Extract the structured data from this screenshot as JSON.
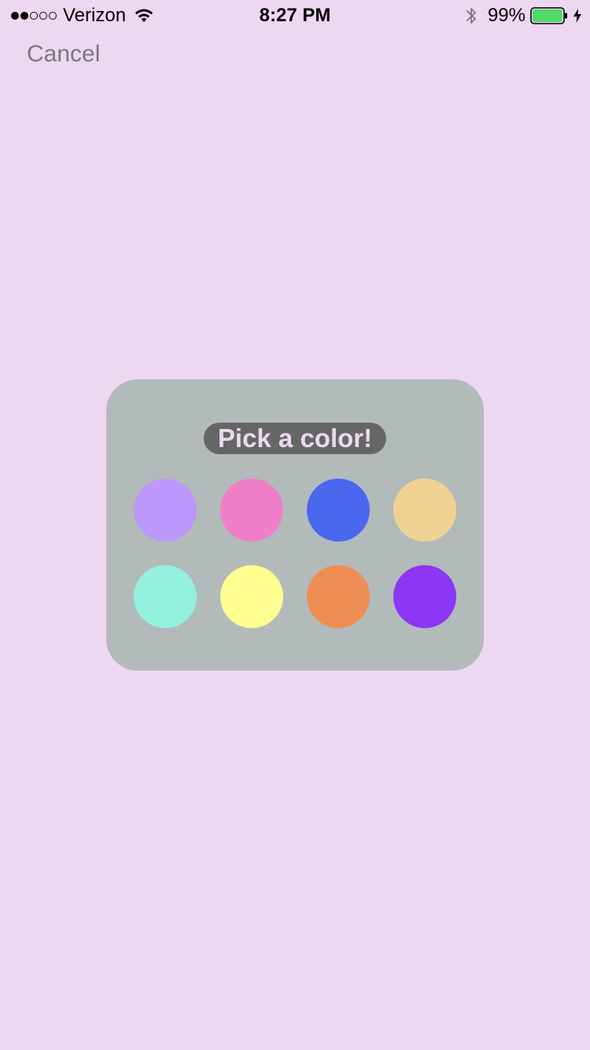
{
  "status_bar": {
    "carrier": "Verizon",
    "time": "8:27 PM",
    "battery_percent": "99%",
    "signal_bars_filled": 2,
    "signal_bars_total": 5,
    "battery_level": 0.99,
    "battery_color": "#4cd964",
    "icons": [
      "wifi-icon",
      "bluetooth-icon",
      "battery-icon",
      "charging-bolt-icon"
    ]
  },
  "nav": {
    "cancel_label": "Cancel"
  },
  "picker": {
    "title": "Pick a color!",
    "swatches": [
      {
        "color": "#bd97fb"
      },
      {
        "color": "#f07fc8"
      },
      {
        "color": "#4967ef"
      },
      {
        "color": "#f0d392"
      },
      {
        "color": "#92f2dd"
      },
      {
        "color": "#fefe91"
      },
      {
        "color": "#ef8e53"
      },
      {
        "color": "#8b37f5"
      }
    ]
  },
  "colors": {
    "background": "#ecd8f1",
    "panel": "#b3baba",
    "title_pill": "#656767",
    "title_text": "#ecd8f1",
    "cancel_text": "#7a7a7a"
  }
}
